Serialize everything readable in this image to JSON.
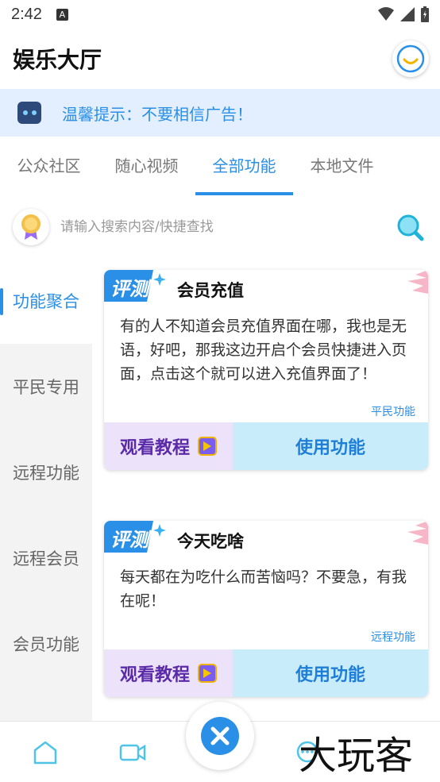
{
  "status_bar": {
    "time": "2:42",
    "notif_glyph": "A"
  },
  "app": {
    "title": "娱乐大厅"
  },
  "notice": {
    "text": "温馨提示：不要相信广告！"
  },
  "tabs": [
    {
      "label": "公众社区"
    },
    {
      "label": "随心视频"
    },
    {
      "label": "全部功能"
    },
    {
      "label": "本地文件"
    }
  ],
  "search": {
    "placeholder": "请输入搜索内容/快捷查找"
  },
  "sidebar": {
    "items": [
      {
        "label": "功能聚合"
      },
      {
        "label": "平民专用"
      },
      {
        "label": "远程功能"
      },
      {
        "label": "远程会员"
      },
      {
        "label": "会员功能"
      }
    ]
  },
  "cards": [
    {
      "badge": "评测",
      "title": "会员充值",
      "desc": "有的人不知道会员充值界面在哪，我也是无语，好吧，那我这边开启个会员快捷进入页面，点击这个就可以进入充值界面了！",
      "tag": "平民功能",
      "tutorial_label": "观看教程",
      "use_label": "使用功能"
    },
    {
      "badge": "评测",
      "title": "今天吃啥",
      "desc": "每天都在为吃什么而苦恼吗？不要急，有我在呢！",
      "tag": "远程功能",
      "tutorial_label": "观看教程",
      "use_label": "使用功能"
    }
  ],
  "watermark": "大玩客",
  "colors": {
    "accent": "#2a8fe6",
    "notice_bg": "#e3efff",
    "tutorial_bg": "#ece3fb",
    "use_bg": "#c9ecfb"
  },
  "icons": [
    "home-icon",
    "video-icon",
    "close-icon",
    "chat-icon"
  ]
}
